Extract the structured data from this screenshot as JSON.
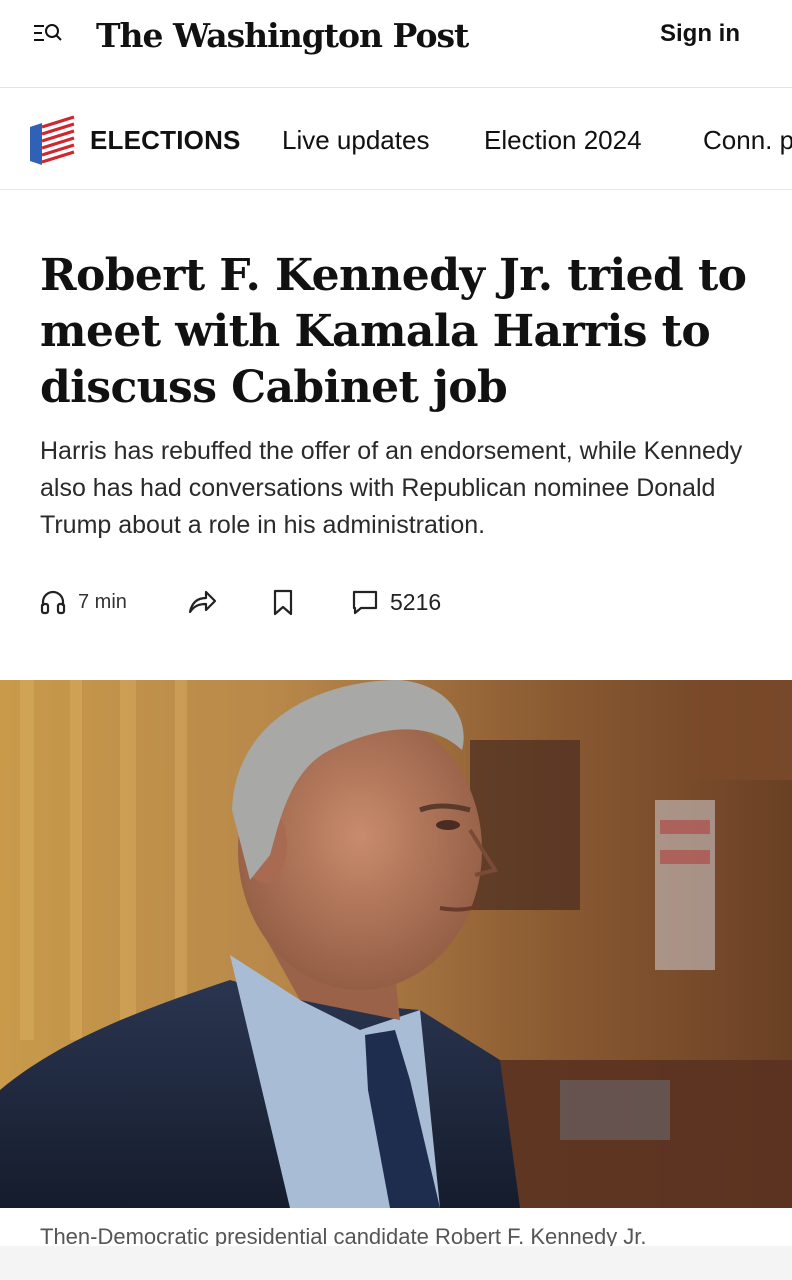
{
  "header": {
    "menu_icon": "menu-search-icon",
    "masthead": "The Washington Post",
    "sign_in": "Sign in"
  },
  "section_nav": {
    "icon": "flag-icon",
    "title": "ELECTIONS",
    "links": [
      "Live updates",
      "Election 2024",
      "Conn. p"
    ]
  },
  "article": {
    "headline_lines": [
      "Robert F. Kennedy Jr. tried to",
      "meet with Kamala Harris to",
      "discuss Cabinet job"
    ],
    "dek": "Harris has rebuffed the offer of an endorsement, while Kennedy also has had conversations with Republican nominee Donald Trump about a role in his administration.",
    "actions": {
      "listen_icon": "headphones-icon",
      "listen_label": "7 min",
      "share_icon": "share-icon",
      "save_icon": "bookmark-icon",
      "comments_icon": "comment-icon",
      "comments_count": "5216"
    },
    "photo_caption": "Then-Democratic presidential candidate Robert F. Kennedy Jr."
  }
}
